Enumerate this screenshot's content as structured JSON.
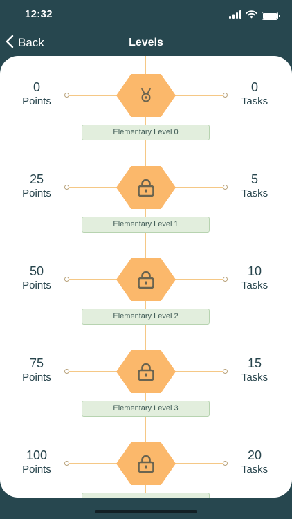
{
  "status_bar": {
    "time": "12:32"
  },
  "nav": {
    "back_label": "Back",
    "title": "Levels"
  },
  "levels": [
    {
      "points": "0",
      "points_unit": "Points",
      "tasks": "0",
      "tasks_unit": "Tasks",
      "label": "Elementary Level 0",
      "icon": "medal-icon",
      "locked": false
    },
    {
      "points": "25",
      "points_unit": "Points",
      "tasks": "5",
      "tasks_unit": "Tasks",
      "label": "Elementary Level 1",
      "icon": "lock-icon",
      "locked": true
    },
    {
      "points": "50",
      "points_unit": "Points",
      "tasks": "10",
      "tasks_unit": "Tasks",
      "label": "Elementary Level 2",
      "icon": "lock-icon",
      "locked": true
    },
    {
      "points": "75",
      "points_unit": "Points",
      "tasks": "15",
      "tasks_unit": "Tasks",
      "label": "Elementary Level 3",
      "icon": "lock-icon",
      "locked": true
    },
    {
      "points": "100",
      "points_unit": "Points",
      "tasks": "20",
      "tasks_unit": "Tasks",
      "label": "",
      "icon": "lock-icon",
      "locked": true
    }
  ],
  "colors": {
    "background": "#27474f",
    "hexagon": "#fbb86b",
    "connector": "#f5c886",
    "label_bg": "#e2eedd",
    "icon": "#6a6450"
  }
}
